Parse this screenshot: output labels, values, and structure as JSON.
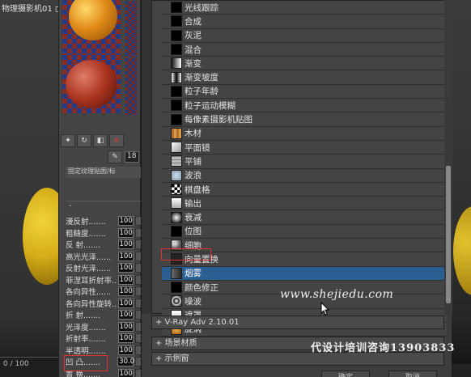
{
  "window": {
    "title": "物理摄影机01 ◻",
    "status_left": "0 / 100"
  },
  "material_editor": {
    "toolbar_num": "18",
    "rollout_label": "固定纹理贴图/标",
    "rollout_dash": "-",
    "props": [
      {
        "label": "漫反射.......",
        "value": "100"
      },
      {
        "label": "粗糙度.......",
        "value": "100"
      },
      {
        "label": "反  射.......",
        "value": "100"
      },
      {
        "label": "高光光泽......",
        "value": "100"
      },
      {
        "label": "反射光泽......",
        "value": "100"
      },
      {
        "label": "菲涅耳折射率..",
        "value": "100"
      },
      {
        "label": "各向异性......",
        "value": "100"
      },
      {
        "label": "各向异性旋转..",
        "value": "100"
      },
      {
        "label": "折  射.......",
        "value": "100"
      },
      {
        "label": "光泽度.......",
        "value": "100"
      },
      {
        "label": "折射率.......",
        "value": "100"
      },
      {
        "label": "半透明.......",
        "value": "100"
      },
      {
        "label": "凹  凸.......",
        "value": "30.0"
      },
      {
        "label": "置  换.......",
        "value": "100"
      }
    ]
  },
  "map_browser": {
    "items": [
      {
        "label": "光线跟踪",
        "icon": "raytrace-icon"
      },
      {
        "label": "合成",
        "icon": "composite-icon"
      },
      {
        "label": "灰泥",
        "icon": "stucco-icon"
      },
      {
        "label": "混合",
        "icon": "mix-icon"
      },
      {
        "label": "渐变",
        "icon": "gradient-icon"
      },
      {
        "label": "渐变坡度",
        "icon": "gradient-ramp-icon"
      },
      {
        "label": "粒子年龄",
        "icon": "particle-age-icon"
      },
      {
        "label": "粒子运动模糊",
        "icon": "particle-mblur-icon"
      },
      {
        "label": "每像素摄影机贴图",
        "icon": "per-pixel-camera-icon"
      },
      {
        "label": "木材",
        "icon": "wood-icon"
      },
      {
        "label": "平面镜",
        "icon": "flat-mirror-icon"
      },
      {
        "label": "平铺",
        "icon": "tiles-icon"
      },
      {
        "label": "波浪",
        "icon": "waves-icon"
      },
      {
        "label": "棋盘格",
        "icon": "checker-icon"
      },
      {
        "label": "输出",
        "icon": "output-icon"
      },
      {
        "label": "衰减",
        "icon": "falloff-icon"
      },
      {
        "label": "位图",
        "icon": "bitmap-icon"
      },
      {
        "label": "细胞",
        "icon": "cellular-icon"
      },
      {
        "label": "向量置换",
        "icon": "vector-displacement-icon"
      },
      {
        "label": "烟雾",
        "icon": "smoke-icon",
        "selected": true
      },
      {
        "label": "颜色修正",
        "icon": "color-correction-icon"
      },
      {
        "label": "噪波",
        "icon": "noise-icon"
      },
      {
        "label": "遮罩",
        "icon": "mask-icon"
      },
      {
        "label": "旋涡",
        "icon": "swirl-icon"
      }
    ],
    "sections": [
      {
        "label": "+ V-Ray Adv 2.10.01"
      },
      {
        "label": "+ 场景材质"
      },
      {
        "label": "+ 示例窗"
      }
    ],
    "ok_label": "确定",
    "cancel_label": "取消"
  },
  "watermarks": {
    "site": "www.shejiedu.com",
    "ad": "代设计培训咨询13903833"
  },
  "colors": {
    "selected_row": "#2b5f93",
    "highlight_box": "#e03030"
  }
}
